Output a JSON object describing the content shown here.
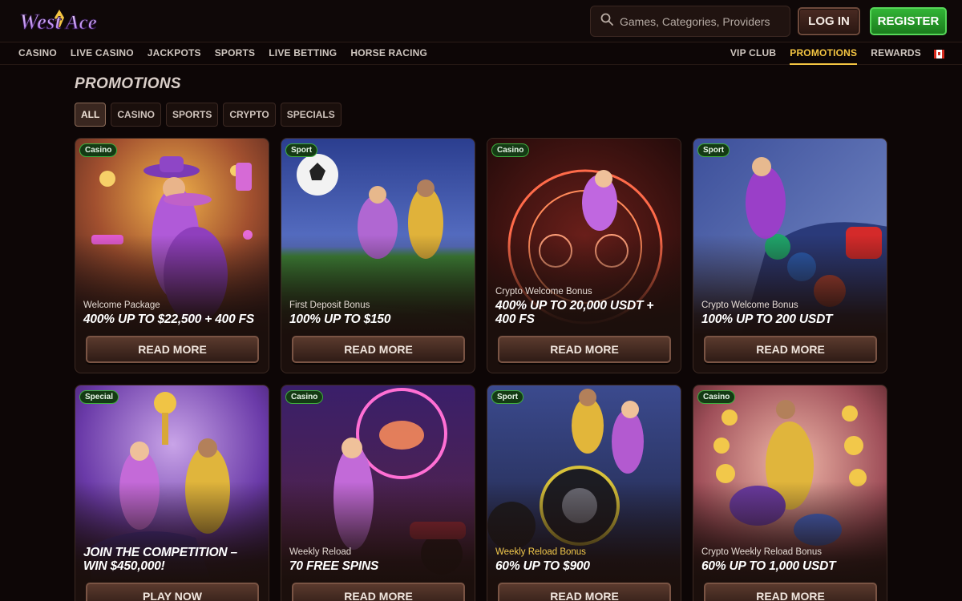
{
  "header": {
    "logo_text": "West Ace",
    "search_placeholder": "Games, Categories, Providers",
    "login_label": "LOG IN",
    "register_label": "REGISTER"
  },
  "nav": {
    "left": [
      "CASINO",
      "LIVE CASINO",
      "JACKPOTS",
      "SPORTS",
      "LIVE BETTING",
      "HORSE RACING"
    ],
    "right": [
      "VIP CLUB",
      "PROMOTIONS",
      "REWARDS"
    ],
    "active": "PROMOTIONS",
    "flag_icon": "canada-flag-icon"
  },
  "page": {
    "title": "PROMOTIONS",
    "filters": [
      "ALL",
      "CASINO",
      "SPORTS",
      "CRYPTO",
      "SPECIALS"
    ],
    "active_filter": "ALL"
  },
  "colors": {
    "accent_gold": "#f4c542",
    "register_green": "#2ea331",
    "badge_green": "#3fae3f",
    "background": "#0d0606"
  },
  "promos": [
    {
      "badge": "Casino",
      "subtitle": "Welcome Package",
      "offer": "400% UP TO $22,500 + 400 FS",
      "button": "READ MORE",
      "art": "cowboy-duo-casino-art"
    },
    {
      "badge": "Sport",
      "subtitle": "First Deposit Bonus",
      "offer": "100% UP TO $150",
      "button": "READ MORE",
      "art": "soccer-cowboys-art"
    },
    {
      "badge": "Casino",
      "subtitle": "Crypto Welcome Bonus",
      "offer": "400% UP TO 20,000 USDT + 400 FS",
      "button": "READ MORE",
      "art": "crypto-roulette-art"
    },
    {
      "badge": "Sport",
      "subtitle": "Crypto Welcome Bonus",
      "offer": "100% UP TO 200 USDT",
      "button": "READ MORE",
      "art": "race-car-cowgirl-art"
    },
    {
      "badge": "Special",
      "subtitle": "",
      "offer": "JOIN THE COMPETITION – WIN $450,000!",
      "button": "PLAY NOW",
      "art": "trophy-competition-art"
    },
    {
      "badge": "Casino",
      "subtitle": "Weekly Reload",
      "offer": "70 FREE SPINS",
      "button": "READ MORE",
      "art": "neon-cowgirl-motorcycle-art"
    },
    {
      "badge": "Sport",
      "subtitle": "Weekly Reload Bonus",
      "offer": "60% UP TO $900",
      "button": "READ MORE",
      "art": "atv-cowboys-art"
    },
    {
      "badge": "Casino",
      "subtitle": "Crypto Weekly Reload Bonus",
      "offer": "60% UP TO 1,000 USDT",
      "button": "READ MORE",
      "art": "crypto-coins-cowboy-art"
    }
  ]
}
